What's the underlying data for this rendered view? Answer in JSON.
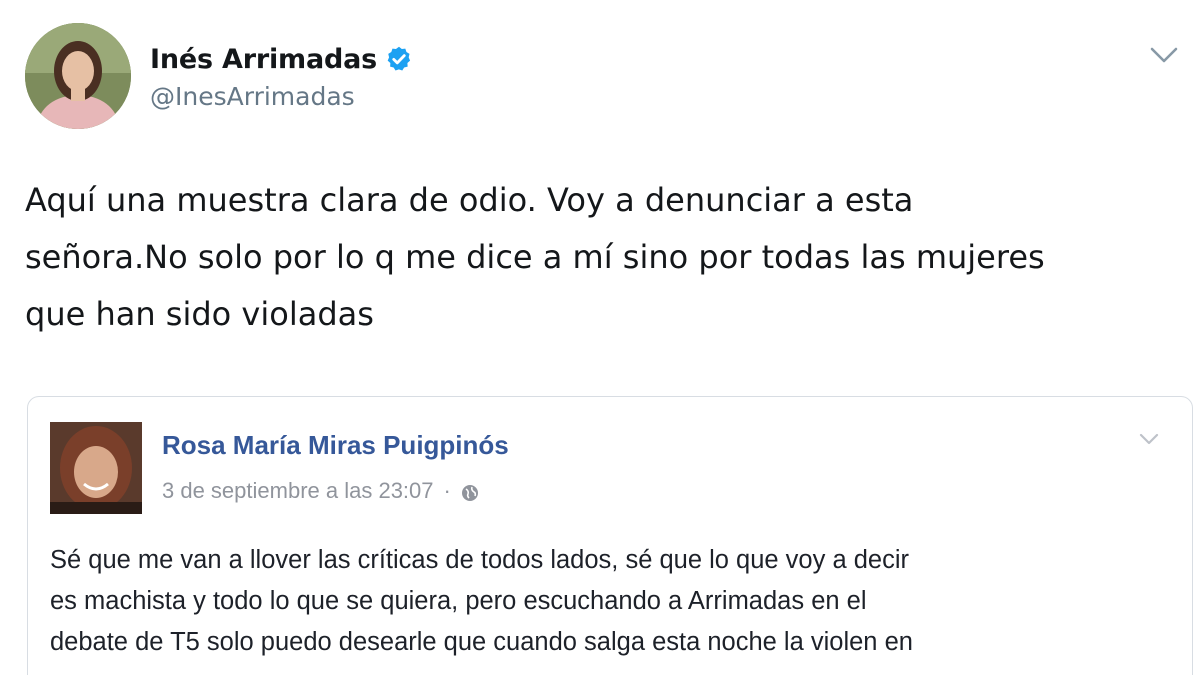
{
  "tweet": {
    "author": {
      "display_name": "Inés Arrimadas",
      "handle": "@InesArrimadas",
      "verified": true,
      "avatar_icon": "profile-photo-avatar"
    },
    "text_lines": [
      "Aquí una muestra clara de odio. Voy a denunciar a esta",
      "señora.No solo por lo q me dice a mí sino por todas las mujeres",
      "que han sido violadas"
    ],
    "menu_icon": "chevron-down-icon"
  },
  "embedded_post": {
    "author": {
      "name": "Rosa María Miras Puigpinós",
      "avatar_icon": "profile-photo-avatar"
    },
    "timestamp": "3 de septiembre a las 23:07",
    "separator": "·",
    "privacy_icon": "globe-icon",
    "menu_icon": "chevron-down-icon",
    "text_lines": [
      "Sé que me van a llover las críticas de todos lados, sé que lo que voy a decir",
      "es machista y todo lo que se quiera, pero escuchando a Arrimadas en el",
      "debate de T5 solo puedo desearle que cuando salga esta noche la violen en"
    ]
  },
  "colors": {
    "verified_blue": "#1da1f2",
    "handle_gray": "#657786",
    "fb_link_blue": "#365899",
    "fb_meta_gray": "#90949c",
    "border": "#d8dde3"
  }
}
